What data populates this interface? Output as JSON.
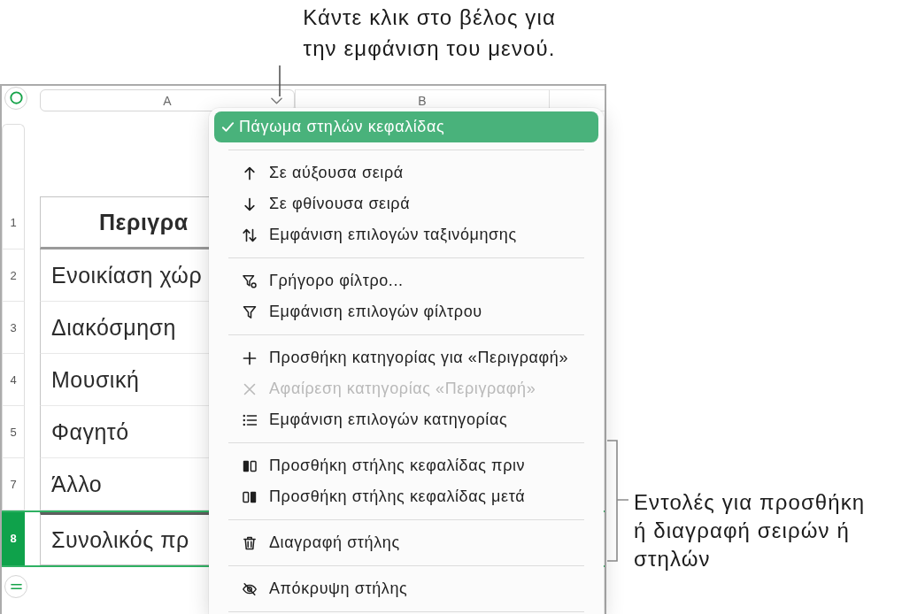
{
  "top_callout": {
    "text": "Κάντε κλικ στο βέλος για την εμφάνιση του μενού."
  },
  "spreadsheet": {
    "columns": [
      {
        "label": "A",
        "selected": true
      },
      {
        "label": "B",
        "selected": false
      }
    ],
    "rows": [
      {
        "number": "1",
        "kind": "header",
        "selected": false,
        "cell": "Περιγρα"
      },
      {
        "number": "2",
        "kind": "body",
        "selected": false,
        "cell": "Ενοικίαση χώρ"
      },
      {
        "number": "3",
        "kind": "body",
        "selected": false,
        "cell": "Διακόσμηση"
      },
      {
        "number": "4",
        "kind": "body",
        "selected": false,
        "cell": "Μουσική"
      },
      {
        "number": "5",
        "kind": "body",
        "selected": false,
        "cell": "Φαγητό"
      },
      {
        "number": "7",
        "kind": "body",
        "selected": false,
        "cell": "Άλλο"
      },
      {
        "number": "8",
        "kind": "footer",
        "selected": true,
        "cell": "Συνολικός πρ"
      }
    ]
  },
  "column_menu": {
    "sections": [
      {
        "items": [
          {
            "label": "Πάγωμα στηλών κεφαλίδας",
            "checked": true,
            "highlighted": true,
            "disabled": false
          }
        ]
      },
      {
        "items": [
          {
            "label": "Σε αύξουσα σειρά",
            "checked": false,
            "highlighted": false,
            "disabled": false
          },
          {
            "label": "Σε φθίνουσα σειρά",
            "checked": false,
            "highlighted": false,
            "disabled": false
          },
          {
            "label": "Εμφάνιση επιλογών ταξινόμησης",
            "checked": false,
            "highlighted": false,
            "disabled": false
          }
        ]
      },
      {
        "items": [
          {
            "label": "Γρήγορο φίλτρο...",
            "checked": false,
            "highlighted": false,
            "disabled": false
          },
          {
            "label": "Εμφάνιση επιλογών φίλτρου",
            "checked": false,
            "highlighted": false,
            "disabled": false
          }
        ]
      },
      {
        "items": [
          {
            "label": "Προσθήκη κατηγορίας για «Περιγραφή»",
            "checked": false,
            "highlighted": false,
            "disabled": false
          },
          {
            "label": "Αφαίρεση κατηγορίας «Περιγραφή»",
            "checked": false,
            "highlighted": false,
            "disabled": true
          },
          {
            "label": "Εμφάνιση επιλογών κατηγορίας",
            "checked": false,
            "highlighted": false,
            "disabled": false
          }
        ]
      },
      {
        "items": [
          {
            "label": "Προσθήκη στήλης κεφαλίδας πριν",
            "checked": false,
            "highlighted": false,
            "disabled": false
          },
          {
            "label": "Προσθήκη στήλης κεφαλίδας μετά",
            "checked": false,
            "highlighted": false,
            "disabled": false
          }
        ]
      },
      {
        "items": [
          {
            "label": "Διαγραφή στήλης",
            "checked": false,
            "highlighted": false,
            "disabled": false
          }
        ]
      },
      {
        "items": [
          {
            "label": "Απόκρυψη στήλης",
            "checked": false,
            "highlighted": false,
            "disabled": false
          }
        ]
      }
    ]
  },
  "side_callout": {
    "text": "Εντολές για προσθήκη ή διαγραφή σειρών ή στηλών"
  }
}
